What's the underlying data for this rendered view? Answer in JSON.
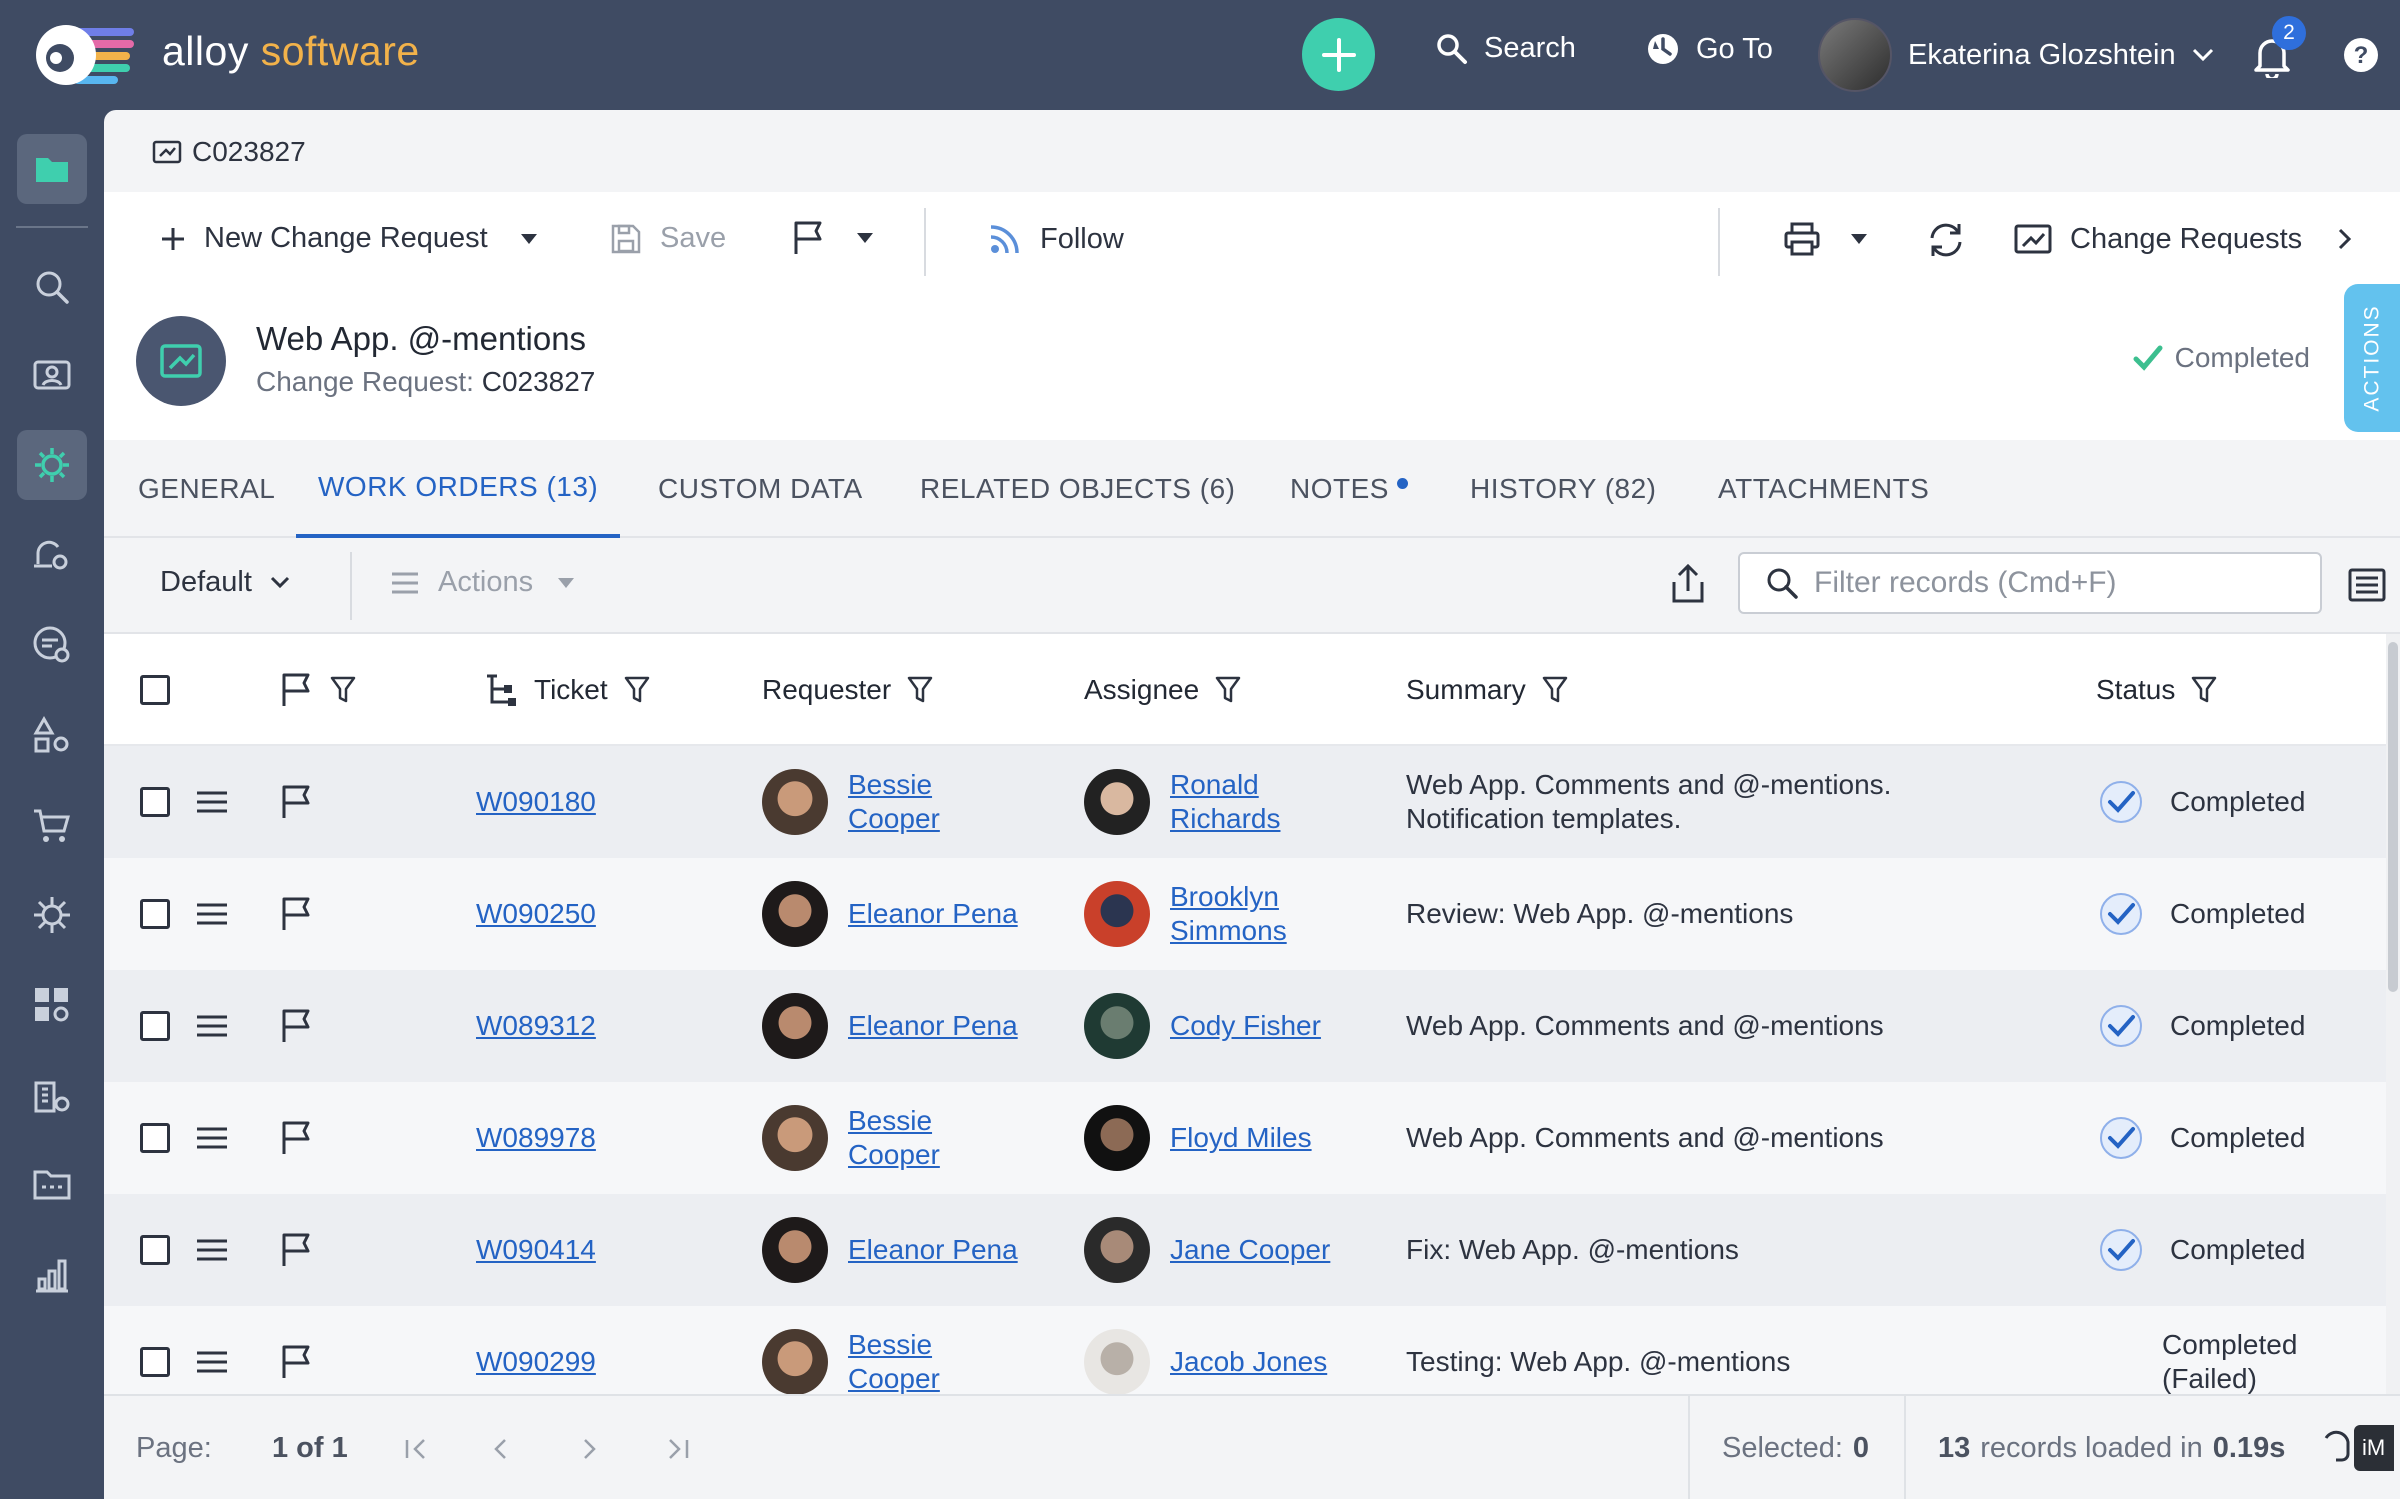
{
  "brand": {
    "part1": "alloy",
    "part2": "software"
  },
  "topbar": {
    "search_label": "Search",
    "goto_label": "Go To",
    "user_name": "Ekaterina Glozshtein",
    "notification_count": "2"
  },
  "breadcrumb": {
    "label": "C023827"
  },
  "toolbar": {
    "new_label": "New Change Request",
    "save_label": "Save",
    "follow_label": "Follow",
    "change_requests_label": "Change Requests"
  },
  "record": {
    "title": "Web App. @-mentions",
    "type_label": "Change Request:",
    "id": "C023827",
    "status": "Completed",
    "actions_tab": "ACTIONS"
  },
  "tabs": [
    {
      "label": "GENERAL"
    },
    {
      "label": "WORK ORDERS (13)"
    },
    {
      "label": "CUSTOM DATA"
    },
    {
      "label": "RELATED OBJECTS (6)"
    },
    {
      "label": "NOTES"
    },
    {
      "label": "HISTORY (82)"
    },
    {
      "label": "ATTACHMENTS"
    }
  ],
  "gridbar": {
    "view_label": "Default",
    "actions_label": "Actions",
    "filter_placeholder": "Filter records (Cmd+F)"
  },
  "columns": {
    "ticket": "Ticket",
    "requester": "Requester",
    "assignee": "Assignee",
    "summary": "Summary",
    "status": "Status"
  },
  "rows": [
    {
      "ticket": "W090180",
      "requester": "Bessie Cooper",
      "assignee": "Ronald Richards",
      "summary": "Web App. Comments and @-mentions. Notification templates.",
      "status": "Completed"
    },
    {
      "ticket": "W090250",
      "requester": "Eleanor Pena",
      "assignee": "Brooklyn Simmons",
      "summary": "Review: Web App. @-mentions",
      "status": "Completed"
    },
    {
      "ticket": "W089312",
      "requester": "Eleanor Pena",
      "assignee": "Cody Fisher",
      "summary": "Web App. Comments and @-mentions",
      "status": "Completed"
    },
    {
      "ticket": "W089978",
      "requester": "Bessie Cooper",
      "assignee": "Floyd Miles",
      "summary": "Web App. Comments and @-mentions",
      "status": "Completed"
    },
    {
      "ticket": "W090414",
      "requester": "Eleanor Pena",
      "assignee": "Jane Cooper",
      "summary": "Fix: Web App. @-mentions",
      "status": "Completed"
    },
    {
      "ticket": "W090299",
      "requester": "Bessie Cooper",
      "assignee": "Jacob Jones",
      "summary": "Testing: Web App. @-mentions",
      "status": "Completed (Failed)"
    }
  ],
  "footer": {
    "page_label": "Page:",
    "page_value": "1 of 1",
    "selected_label": "Selected:",
    "selected_value": "0",
    "records_count": "13",
    "records_text": "records loaded in",
    "records_time": "0.19s",
    "im_label": "iM"
  },
  "colors": {
    "accent": "#2463c4",
    "brand_orange": "#f2b24a",
    "add_button": "#3fcfae",
    "sidebar": "#3f4b63",
    "actions_tab": "#63c2ee"
  }
}
